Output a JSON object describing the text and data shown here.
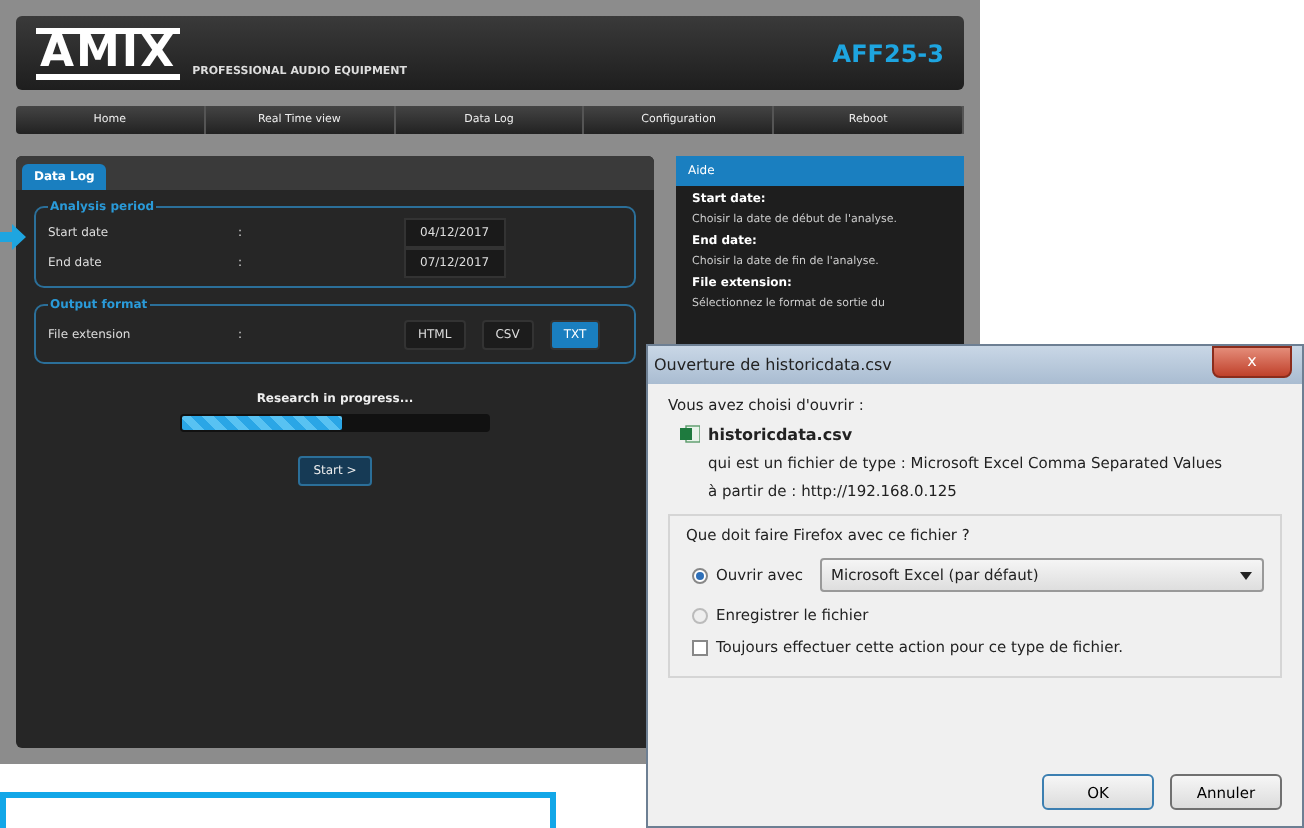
{
  "header": {
    "logo": "AMIX",
    "tagline": "PROFESSIONAL AUDIO EQUIPMENT",
    "model": "AFF25-3"
  },
  "nav": [
    {
      "label": "Home"
    },
    {
      "label": "Real Time view"
    },
    {
      "label": "Data Log"
    },
    {
      "label": "Configuration"
    },
    {
      "label": "Reboot"
    }
  ],
  "panel": {
    "tab": "Data Log",
    "analysis_period": {
      "legend": "Analysis period",
      "rows": [
        {
          "label": "Start date",
          "separator": ":",
          "value": "04/12/2017"
        },
        {
          "label": "End date",
          "separator": ":",
          "value": "07/12/2017"
        }
      ]
    },
    "output_format": {
      "legend": "Output format",
      "label": "File extension",
      "separator": ":",
      "options": [
        {
          "label": "HTML",
          "selected": false
        },
        {
          "label": "CSV",
          "selected": false
        },
        {
          "label": "TXT",
          "selected": true
        }
      ]
    },
    "progress": {
      "label": "Research in progress...",
      "level": 0.52
    },
    "start_button": "Start >"
  },
  "help": {
    "title": "Aide",
    "items": [
      {
        "kind": "heading",
        "text": "Start date:"
      },
      {
        "kind": "text",
        "text": "Choisir la date de début de l'analyse."
      },
      {
        "kind": "heading",
        "text": "End date:"
      },
      {
        "kind": "text",
        "text": "Choisir la date de fin de l'analyse."
      },
      {
        "kind": "heading",
        "text": "File extension:"
      },
      {
        "kind": "text",
        "text": "Sélectionnez le format de sortie du"
      }
    ]
  },
  "dialog": {
    "title": "Ouverture de historicdata.csv",
    "close": "x",
    "intro": "Vous avez choisi d'ouvrir :",
    "file_name": "historicdata.csv",
    "type_line": "qui est un fichier de type : Microsoft Excel Comma Separated Values",
    "source_line": "à partir de : http://192.168.0.125",
    "question": "Que doit faire Firefox avec ce fichier ?",
    "choices": [
      {
        "label": "Ouvrir avec",
        "selected": true,
        "app": "Microsoft Excel (par défaut)"
      },
      {
        "label": "Enregistrer le fichier",
        "selected": false
      }
    ],
    "always": {
      "label": "Toujours effectuer cette action pour ce type de fichier.",
      "checked": false
    },
    "buttons": [
      "OK",
      "Annuler"
    ]
  }
}
